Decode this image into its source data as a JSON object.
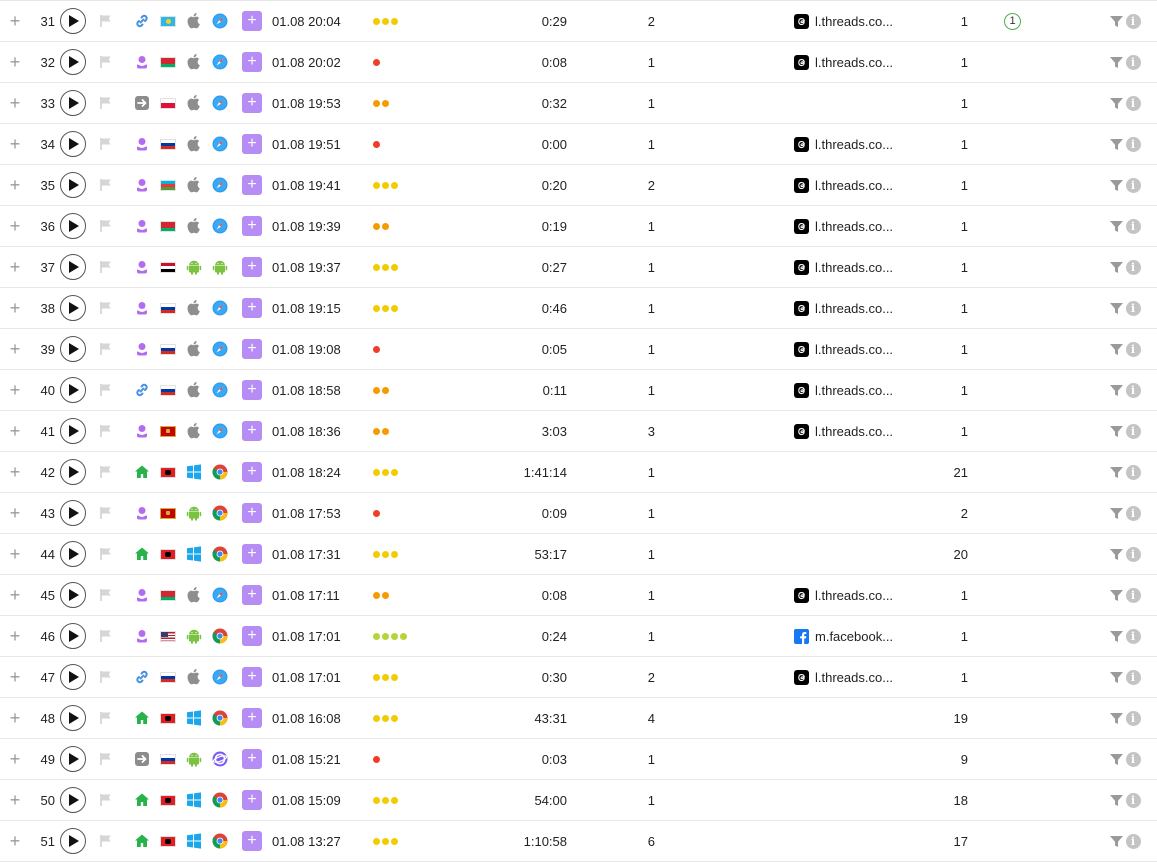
{
  "colors": {
    "dot_red": "#f23c2a",
    "dot_orange": "#f59b00",
    "dot_yellow": "#f2cc00",
    "dot_green": "#b4d43a",
    "accent_purple": "#b68cf5"
  },
  "rows": [
    {
      "num": "31",
      "source": "link-icon",
      "country": "kazakhstan-flag",
      "os": "apple-icon",
      "browser": "safari-icon",
      "date": "01.08 20:04",
      "dots": [
        "yellow",
        "yellow",
        "yellow"
      ],
      "duration": "0:29",
      "pages": "2",
      "referrer": "l.threads.co...",
      "ref_icon": "threads-icon",
      "visits": "1",
      "badge": "1"
    },
    {
      "num": "32",
      "source": "person-icon",
      "country": "belarus-flag",
      "os": "apple-icon",
      "browser": "safari-icon",
      "date": "01.08 20:02",
      "dots": [
        "red"
      ],
      "duration": "0:08",
      "pages": "1",
      "referrer": "l.threads.co...",
      "ref_icon": "threads-icon",
      "visits": "1",
      "badge": ""
    },
    {
      "num": "33",
      "source": "arrow-icon",
      "country": "poland-flag",
      "os": "apple-icon",
      "browser": "safari-icon",
      "date": "01.08 19:53",
      "dots": [
        "orange",
        "orange"
      ],
      "duration": "0:32",
      "pages": "1",
      "referrer": "",
      "ref_icon": "",
      "visits": "1",
      "badge": ""
    },
    {
      "num": "34",
      "source": "person-icon",
      "country": "russia-flag",
      "os": "apple-icon",
      "browser": "safari-icon",
      "date": "01.08 19:51",
      "dots": [
        "red"
      ],
      "duration": "0:00",
      "pages": "1",
      "referrer": "l.threads.co...",
      "ref_icon": "threads-icon",
      "visits": "1",
      "badge": ""
    },
    {
      "num": "35",
      "source": "person-icon",
      "country": "azerbaijan-flag",
      "os": "apple-icon",
      "browser": "safari-icon",
      "date": "01.08 19:41",
      "dots": [
        "yellow",
        "yellow",
        "yellow"
      ],
      "duration": "0:20",
      "pages": "2",
      "referrer": "l.threads.co...",
      "ref_icon": "threads-icon",
      "visits": "1",
      "badge": ""
    },
    {
      "num": "36",
      "source": "person-icon",
      "country": "belarus-flag",
      "os": "apple-icon",
      "browser": "safari-icon",
      "date": "01.08 19:39",
      "dots": [
        "orange",
        "orange"
      ],
      "duration": "0:19",
      "pages": "1",
      "referrer": "l.threads.co...",
      "ref_icon": "threads-icon",
      "visits": "1",
      "badge": ""
    },
    {
      "num": "37",
      "source": "person-icon",
      "country": "egypt-flag",
      "os": "android-icon",
      "browser": "android-icon",
      "date": "01.08 19:37",
      "dots": [
        "yellow",
        "yellow",
        "yellow"
      ],
      "duration": "0:27",
      "pages": "1",
      "referrer": "l.threads.co...",
      "ref_icon": "threads-icon",
      "visits": "1",
      "badge": ""
    },
    {
      "num": "38",
      "source": "person-icon",
      "country": "russia-flag",
      "os": "apple-icon",
      "browser": "safari-icon",
      "date": "01.08 19:15",
      "dots": [
        "yellow",
        "yellow",
        "yellow"
      ],
      "duration": "0:46",
      "pages": "1",
      "referrer": "l.threads.co...",
      "ref_icon": "threads-icon",
      "visits": "1",
      "badge": ""
    },
    {
      "num": "39",
      "source": "person-icon",
      "country": "russia-flag",
      "os": "apple-icon",
      "browser": "safari-icon",
      "date": "01.08 19:08",
      "dots": [
        "red"
      ],
      "duration": "0:05",
      "pages": "1",
      "referrer": "l.threads.co...",
      "ref_icon": "threads-icon",
      "visits": "1",
      "badge": ""
    },
    {
      "num": "40",
      "source": "link-icon",
      "country": "russia-flag",
      "os": "apple-icon",
      "browser": "safari-icon",
      "date": "01.08 18:58",
      "dots": [
        "orange",
        "orange"
      ],
      "duration": "0:11",
      "pages": "1",
      "referrer": "l.threads.co...",
      "ref_icon": "threads-icon",
      "visits": "1",
      "badge": ""
    },
    {
      "num": "41",
      "source": "person-icon",
      "country": "montenegro-flag",
      "os": "apple-icon",
      "browser": "safari-icon",
      "date": "01.08 18:36",
      "dots": [
        "orange",
        "orange"
      ],
      "duration": "3:03",
      "pages": "3",
      "referrer": "l.threads.co...",
      "ref_icon": "threads-icon",
      "visits": "1",
      "badge": ""
    },
    {
      "num": "42",
      "source": "home-icon",
      "country": "albania-flag",
      "os": "windows-icon",
      "browser": "chrome-icon",
      "date": "01.08 18:24",
      "dots": [
        "yellow",
        "yellow",
        "yellow"
      ],
      "duration": "1:41:14",
      "pages": "1",
      "referrer": "",
      "ref_icon": "",
      "visits": "21",
      "badge": ""
    },
    {
      "num": "43",
      "source": "person-icon",
      "country": "montenegro-flag",
      "os": "android-icon",
      "browser": "chrome-icon",
      "date": "01.08 17:53",
      "dots": [
        "red"
      ],
      "duration": "0:09",
      "pages": "1",
      "referrer": "",
      "ref_icon": "",
      "visits": "2",
      "badge": ""
    },
    {
      "num": "44",
      "source": "home-icon",
      "country": "albania-flag",
      "os": "windows-icon",
      "browser": "chrome-icon",
      "date": "01.08 17:31",
      "dots": [
        "yellow",
        "yellow",
        "yellow"
      ],
      "duration": "53:17",
      "pages": "1",
      "referrer": "",
      "ref_icon": "",
      "visits": "20",
      "badge": ""
    },
    {
      "num": "45",
      "source": "person-icon",
      "country": "belarus-flag",
      "os": "apple-icon",
      "browser": "safari-icon",
      "date": "01.08 17:11",
      "dots": [
        "orange",
        "orange"
      ],
      "duration": "0:08",
      "pages": "1",
      "referrer": "l.threads.co...",
      "ref_icon": "threads-icon",
      "visits": "1",
      "badge": ""
    },
    {
      "num": "46",
      "source": "person-icon",
      "country": "usa-flag",
      "os": "android-icon",
      "browser": "chrome-icon",
      "date": "01.08 17:01",
      "dots": [
        "green",
        "green",
        "green",
        "green"
      ],
      "duration": "0:24",
      "pages": "1",
      "referrer": "m.facebook...",
      "ref_icon": "facebook-icon",
      "visits": "1",
      "badge": ""
    },
    {
      "num": "47",
      "source": "link-icon",
      "country": "russia-flag",
      "os": "apple-icon",
      "browser": "safari-icon",
      "date": "01.08 17:01",
      "dots": [
        "yellow",
        "yellow",
        "yellow"
      ],
      "duration": "0:30",
      "pages": "2",
      "referrer": "l.threads.co...",
      "ref_icon": "threads-icon",
      "visits": "1",
      "badge": ""
    },
    {
      "num": "48",
      "source": "home-icon",
      "country": "albania-flag",
      "os": "windows-icon",
      "browser": "chrome-icon",
      "date": "01.08 16:08",
      "dots": [
        "yellow",
        "yellow",
        "yellow"
      ],
      "duration": "43:31",
      "pages": "4",
      "referrer": "",
      "ref_icon": "",
      "visits": "19",
      "badge": ""
    },
    {
      "num": "49",
      "source": "arrow-icon",
      "country": "russia-flag",
      "os": "android-icon",
      "browser": "samsung-internet-icon",
      "date": "01.08 15:21",
      "dots": [
        "red"
      ],
      "duration": "0:03",
      "pages": "1",
      "referrer": "",
      "ref_icon": "",
      "visits": "9",
      "badge": ""
    },
    {
      "num": "50",
      "source": "home-icon",
      "country": "albania-flag",
      "os": "windows-icon",
      "browser": "chrome-icon",
      "date": "01.08 15:09",
      "dots": [
        "yellow",
        "yellow",
        "yellow"
      ],
      "duration": "54:00",
      "pages": "1",
      "referrer": "",
      "ref_icon": "",
      "visits": "18",
      "badge": ""
    },
    {
      "num": "51",
      "source": "home-icon",
      "country": "albania-flag",
      "os": "windows-icon",
      "browser": "chrome-icon",
      "date": "01.08 13:27",
      "dots": [
        "yellow",
        "yellow",
        "yellow"
      ],
      "duration": "1:10:58",
      "pages": "6",
      "referrer": "",
      "ref_icon": "",
      "visits": "17",
      "badge": ""
    }
  ]
}
